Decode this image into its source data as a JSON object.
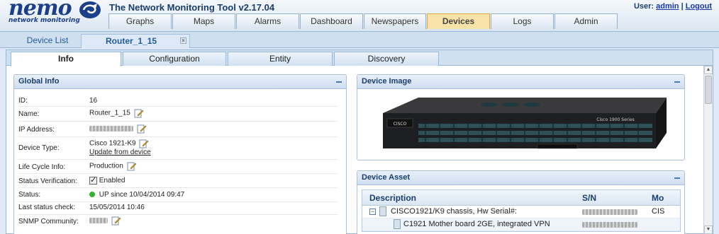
{
  "header": {
    "logo_word": "nemo",
    "logo_tag": "network monitoring",
    "app_title": "The Network Monitoring Tool v2.17.04",
    "user_label": "User:",
    "user_name": "admin",
    "separator": "|",
    "logout": "Logout"
  },
  "main_tabs": [
    {
      "label": "Graphs"
    },
    {
      "label": "Maps"
    },
    {
      "label": "Alarms"
    },
    {
      "label": "Dashboard"
    },
    {
      "label": "Newspapers"
    },
    {
      "label": "Devices",
      "active": true
    },
    {
      "label": "Logs"
    },
    {
      "label": "Admin"
    }
  ],
  "sub_tabs": {
    "device_list": "Device List",
    "router": "Router_1_15",
    "close_symbol": "☒"
  },
  "inner_tabs": [
    {
      "label": "Info",
      "active": true
    },
    {
      "label": "Configuration"
    },
    {
      "label": "Entity"
    },
    {
      "label": "Discovery"
    }
  ],
  "global_info": {
    "title": "Global Info",
    "rows": {
      "id": {
        "label": "ID:",
        "value": "16"
      },
      "name": {
        "label": "Name:",
        "value": "Router_1_15"
      },
      "ip": {
        "label": "IP Address:"
      },
      "device_type": {
        "label": "Device Type:",
        "value": "Cisco 1921-K9",
        "link": "Update from device"
      },
      "lifecycle": {
        "label": "Life Cycle Info:",
        "value": "Production"
      },
      "status_verification": {
        "label": "Status Verification:",
        "value": "Enabled"
      },
      "status": {
        "label": "Status:",
        "value": "UP since 10/04/2014 09:47"
      },
      "last_check": {
        "label": "Last status check:",
        "value": "15/05/2014 10:46"
      },
      "snmp": {
        "label": "SNMP Community:"
      }
    }
  },
  "device_image": {
    "title": "Device Image",
    "brand": "CISCO",
    "series": "Cisco 1900 Series"
  },
  "device_asset": {
    "title": "Device Asset",
    "columns": [
      "Description",
      "S/N",
      "Mo"
    ],
    "rows": [
      {
        "description": "CISCO1921/K9 chassis, Hw Serial#:",
        "model": "CIS"
      },
      {
        "description": "C1921 Mother board 2GE, integrated VPN",
        "model": ""
      }
    ]
  },
  "colors": {
    "active_tab": "#fbe2a8",
    "accent": "#1b3d6e",
    "status_up": "#2fb62f"
  }
}
